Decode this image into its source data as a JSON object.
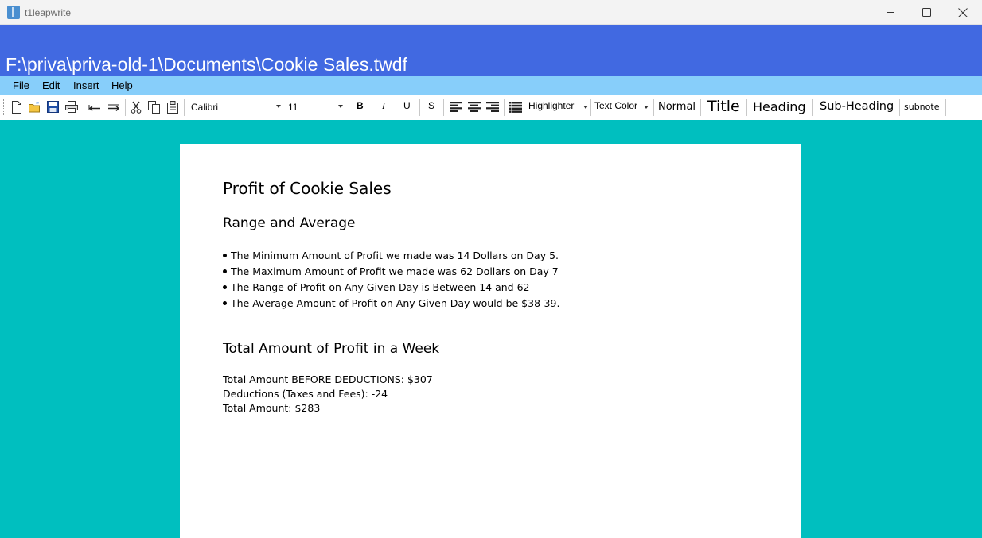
{
  "window": {
    "title": "t1leapwrite",
    "minimize_icon": "minimize-icon",
    "maximize_icon": "maximize-icon",
    "close_icon": "close-icon"
  },
  "file_path": "F:\\priva\\priva-old-1\\Documents\\Cookie Sales.twdf",
  "menu": [
    "File",
    "Edit",
    "Insert",
    "Help"
  ],
  "toolbar": {
    "icons": [
      "new-document-icon",
      "open-folder-icon",
      "save-icon",
      "print-icon",
      "undo-icon",
      "redo-icon",
      "cut-icon",
      "copy-icon",
      "paste-icon"
    ],
    "font_family": "Calibri",
    "font_size": "11",
    "bold": "B",
    "italic": "I",
    "underline": "U",
    "strikethrough": "S",
    "highlighter": "Highlighter",
    "text_color": "Text Color",
    "styles": {
      "normal": "Normal",
      "title": "Title",
      "heading": "Heading",
      "subheading": "Sub-Heading",
      "subnote": "subnote"
    }
  },
  "document": {
    "title": "Profit of Cookie Sales",
    "section1": {
      "heading": "Range and Average",
      "bullets": [
        "The Minimum Amount of Profit we made was 14 Dollars on Day 5.",
        "The Maximum Amount of Profit we made was 62 Dollars on Day 7",
        "The Range of Profit on Any Given Day is Between 14 and 62",
        "The Average Amount of Profit on Any Given Day would be $38-39."
      ]
    },
    "section2": {
      "heading": "Total Amount of Profit in a Week",
      "lines": [
        "Total Amount BEFORE DEDUCTIONS: $307",
        "Deductions (Taxes and Fees): -24",
        "Total Amount: $283"
      ]
    }
  },
  "colors": {
    "path_bar": "#4169e1",
    "menu_bar": "#87cefa",
    "workspace": "#00bfbf"
  }
}
